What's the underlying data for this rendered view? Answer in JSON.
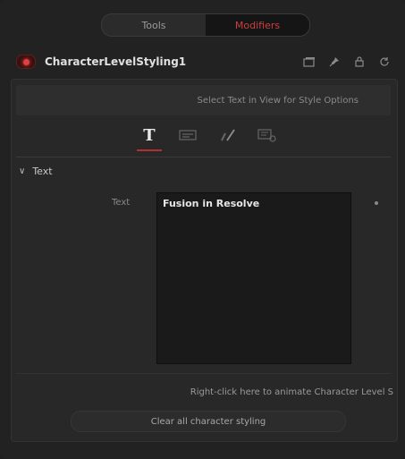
{
  "tabs": [
    {
      "label": "Tools"
    },
    {
      "label": "Modifiers"
    }
  ],
  "node": {
    "title": "CharacterLevelStyling1",
    "icons": [
      "view-icon",
      "pin-icon",
      "lock-icon",
      "reset-icon"
    ]
  },
  "hint": "Select Text in View for Style Options",
  "icon_tabs": [
    "text-tab-icon",
    "layout-tab-icon",
    "brush-tab-icon",
    "settings-tab-icon"
  ],
  "section": {
    "title": "Text",
    "field_label": "Text",
    "field_value": "Fusion in Resolve"
  },
  "right_click_hint": "Right-click here to animate Character Level S",
  "clear_button": "Clear all character styling",
  "colors": {
    "accent": "#c84040",
    "background": "#222222",
    "panel": "#282828"
  }
}
